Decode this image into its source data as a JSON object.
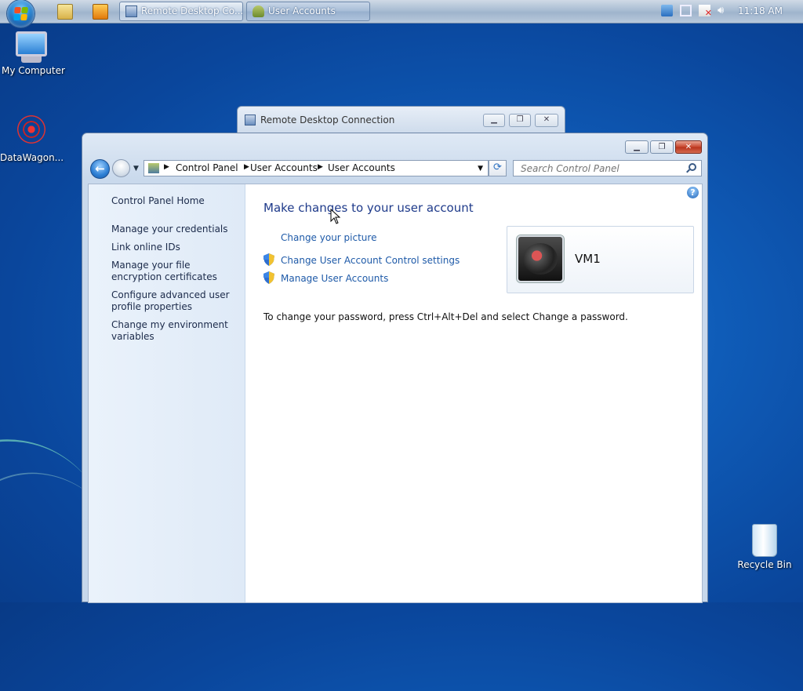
{
  "taskbar": {
    "buttons": [
      {
        "label": "Remote Desktop Co..."
      },
      {
        "label": "User Accounts"
      }
    ],
    "clock": "11:18 AM"
  },
  "desktop": {
    "icons": [
      {
        "label": "My Computer"
      },
      {
        "label": "DataWagon..."
      },
      {
        "label": "Recycle Bin"
      }
    ]
  },
  "rdc_window": {
    "title": "Remote Desktop Connection"
  },
  "window": {
    "breadcrumb": [
      "Control Panel",
      "User Accounts",
      "User Accounts"
    ],
    "search_placeholder": "Search Control Panel",
    "left_pane": {
      "home": "Control Panel Home",
      "links": [
        "Manage your credentials",
        "Link online IDs",
        "Manage your file encryption certificates",
        "Configure advanced user profile properties",
        "Change my environment variables"
      ]
    },
    "main": {
      "heading": "Make changes to your user account",
      "tasks": [
        "Change your picture",
        "Change User Account Control settings",
        "Manage User Accounts"
      ],
      "note": "To change your password, press Ctrl+Alt+Del and select Change a password.",
      "account_name": "VM1"
    }
  }
}
